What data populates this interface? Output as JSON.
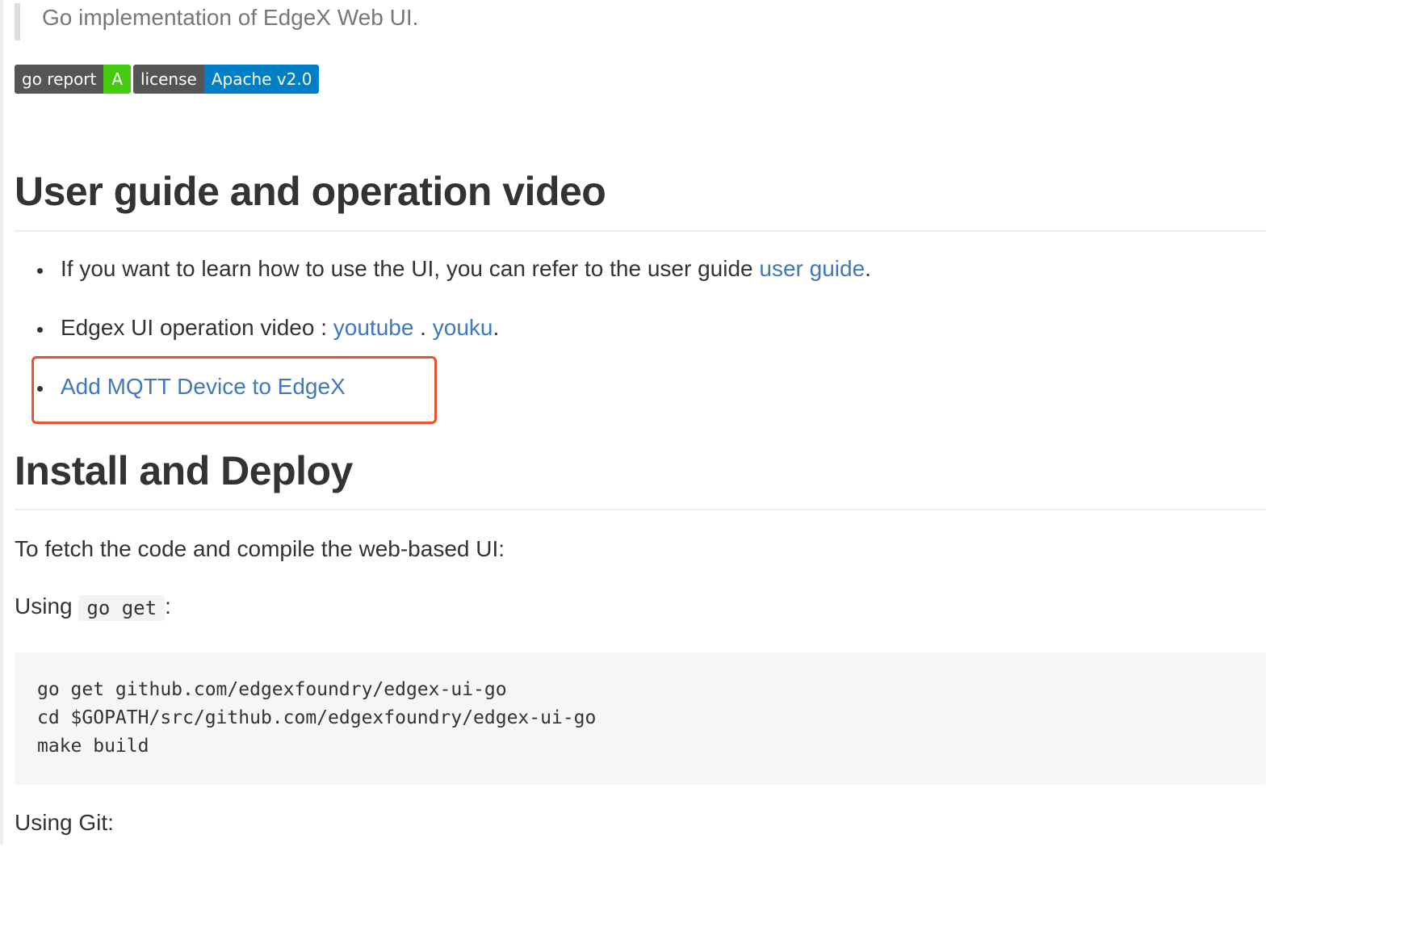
{
  "blockquote": {
    "text": "Go implementation of EdgeX Web UI."
  },
  "badges": [
    {
      "label": "go report",
      "value": "A",
      "color": "#44cc11"
    },
    {
      "label": "license",
      "value": "Apache v2.0",
      "color": "#007ec6"
    }
  ],
  "section_user_guide": {
    "heading": "User guide and operation video",
    "items": [
      {
        "text": "If you want to learn how to use the UI, you can refer to the user guide ",
        "link": "user guide",
        "suffix": "."
      },
      {
        "text": "Edgex UI operation video : ",
        "link_1": "youtube",
        "separator": " . ",
        "link_2": "youku",
        "suffix": "."
      },
      {
        "link": "Add MQTT Device to EdgeX",
        "highlighted": true
      }
    ]
  },
  "section_install": {
    "heading": "Install and Deploy",
    "intro": "To fetch the code and compile the web-based UI:",
    "using_go_get": {
      "prefix": "Using ",
      "code": "go get",
      "suffix": ":"
    },
    "code_lines": [
      "go get github.com/edgexfoundry/edgex-ui-go",
      "cd $GOPATH/src/github.com/edgexfoundry/edgex-ui-go",
      "make build"
    ],
    "using_git": "Using Git:"
  },
  "colors": {
    "link": "#4078c0",
    "highlight_border": "#e8532b",
    "text": "#333333"
  }
}
